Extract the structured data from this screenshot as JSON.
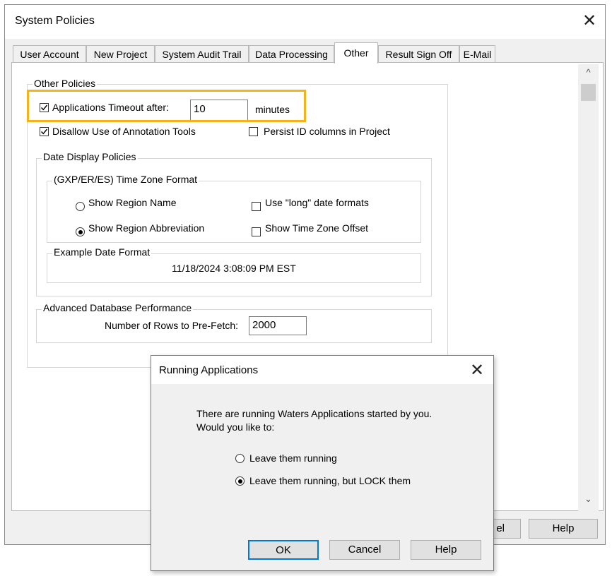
{
  "main_dialog": {
    "title": "System Policies",
    "close_glyph": "✕",
    "tabs": [
      {
        "label": "User Account",
        "active": false
      },
      {
        "label": "New Project",
        "active": false
      },
      {
        "label": "System Audit Trail",
        "active": false
      },
      {
        "label": "Data Processing",
        "active": false
      },
      {
        "label": "Other",
        "active": true
      },
      {
        "label": "Result Sign Off",
        "active": false
      },
      {
        "label": "E-Mail",
        "active": false
      }
    ],
    "other_policies": {
      "group_label": "Other Policies",
      "timeout_checkbox_label": "Applications Timeout after:",
      "timeout_checked": true,
      "timeout_value": "10",
      "timeout_units": "minutes",
      "annotation_checkbox_label": "Disallow Use of Annotation Tools",
      "annotation_checked": true,
      "persist_checkbox_label": "Persist ID columns in Project",
      "persist_checked": false
    },
    "date_display": {
      "group_label": "Date Display Policies",
      "timezone_group_label": "(GXP/ER/ES) Time Zone Format",
      "radio_region_name": "Show Region Name",
      "radio_region_abbrev": "Show Region Abbreviation",
      "selected_radio": "region_abbrev",
      "long_dates_label": "Use \"long\" date formats",
      "long_dates_checked": false,
      "tz_offset_label": "Show Time Zone Offset",
      "tz_offset_checked": false,
      "example_group_label": "Example Date Format",
      "example_value": "11/18/2024 3:08:09 PM EST"
    },
    "db_performance": {
      "group_label": "Advanced Database Performance",
      "prefetch_label": "Number of Rows to Pre-Fetch:",
      "prefetch_value": "2000"
    },
    "buttons": {
      "cancel_partial": "el",
      "help": "Help"
    },
    "highlight_color": "#f4b31b",
    "scroll_up_glyph": "^",
    "scroll_down_glyph": "⌄"
  },
  "popup_dialog": {
    "title": "Running Applications",
    "close_glyph": "✕",
    "message_line1": "There are running Waters Applications started by you.",
    "message_line2": "Would you like to:",
    "option_leave": "Leave them running",
    "option_lock": "Leave them running, but LOCK them",
    "selected_option": "lock",
    "ok_label": "OK",
    "cancel_label": "Cancel",
    "help_label": "Help",
    "focus_color": "#0078d7"
  }
}
